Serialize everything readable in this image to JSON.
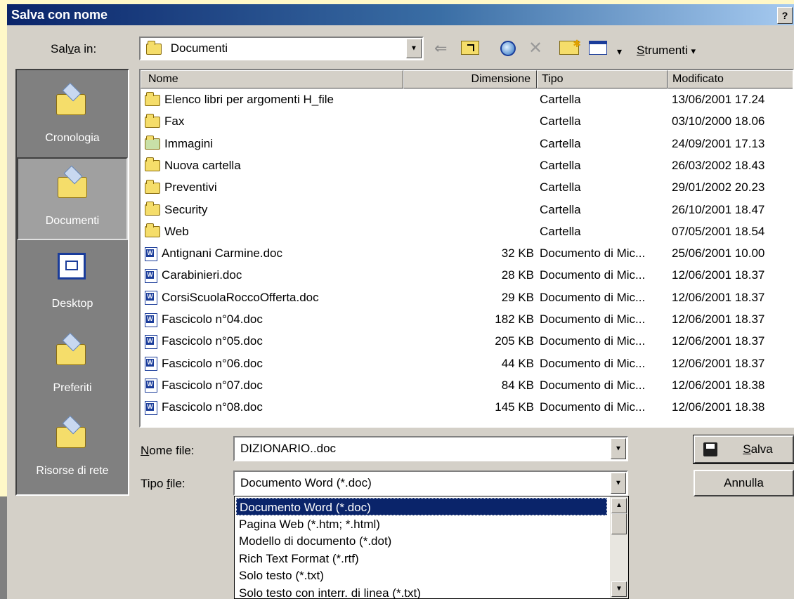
{
  "window": {
    "title": "Salva con nome",
    "help_glyph": "?"
  },
  "lookin": {
    "label_pre": "Sal",
    "label_key": "v",
    "label_post": "a in:",
    "value": "Documenti"
  },
  "toolbar": {
    "icons": [
      "back-arrow-icon",
      "up-folder-icon",
      "search-web-icon",
      "delete-icon",
      "new-folder-icon",
      "views-icon"
    ],
    "tools_key": "S",
    "tools_rest": "trumenti",
    "back_glyph": "⇐",
    "delete_glyph": "✕",
    "dropdown_glyph": "▾"
  },
  "places": [
    {
      "label": "Cronologia",
      "icon": "history-icon"
    },
    {
      "label": "Documenti",
      "icon": "my-documents-icon"
    },
    {
      "label": "Desktop",
      "icon": "desktop-icon"
    },
    {
      "label": "Preferiti",
      "icon": "favorites-icon"
    },
    {
      "label": "Risorse di rete",
      "icon": "network-icon"
    }
  ],
  "columns": {
    "name": "Nome",
    "size": "Dimensione",
    "type": "Tipo",
    "modified": "Modificato"
  },
  "files": [
    {
      "name": "Elenco libri per argomenti H_file",
      "size": "",
      "type": "Cartella",
      "modified": "13/06/2001 17.24",
      "icon": "folder"
    },
    {
      "name": "Fax",
      "size": "",
      "type": "Cartella",
      "modified": "03/10/2000 18.06",
      "icon": "folder"
    },
    {
      "name": "Immagini",
      "size": "",
      "type": "Cartella",
      "modified": "24/09/2001 17.13",
      "icon": "folder-pictures"
    },
    {
      "name": "Nuova cartella",
      "size": "",
      "type": "Cartella",
      "modified": "26/03/2002 18.43",
      "icon": "folder"
    },
    {
      "name": "Preventivi",
      "size": "",
      "type": "Cartella",
      "modified": "29/01/2002 20.23",
      "icon": "folder"
    },
    {
      "name": "Security",
      "size": "",
      "type": "Cartella",
      "modified": "26/10/2001 18.47",
      "icon": "folder"
    },
    {
      "name": "Web",
      "size": "",
      "type": "Cartella",
      "modified": "07/05/2001 18.54",
      "icon": "folder"
    },
    {
      "name": "Antignani Carmine.doc",
      "size": "32 KB",
      "type": "Documento di Mic...",
      "modified": "25/06/2001 10.00",
      "icon": "word-doc"
    },
    {
      "name": "Carabinieri.doc",
      "size": "28 KB",
      "type": "Documento di Mic...",
      "modified": "12/06/2001 18.37",
      "icon": "word-doc"
    },
    {
      "name": "CorsiScuolaRoccoOfferta.doc",
      "size": "29 KB",
      "type": "Documento di Mic...",
      "modified": "12/06/2001 18.37",
      "icon": "word-doc"
    },
    {
      "name": "Fascicolo n°04.doc",
      "size": "182 KB",
      "type": "Documento di Mic...",
      "modified": "12/06/2001 18.37",
      "icon": "word-doc"
    },
    {
      "name": "Fascicolo n°05.doc",
      "size": "205 KB",
      "type": "Documento di Mic...",
      "modified": "12/06/2001 18.37",
      "icon": "word-doc"
    },
    {
      "name": "Fascicolo n°06.doc",
      "size": "44 KB",
      "type": "Documento di Mic...",
      "modified": "12/06/2001 18.37",
      "icon": "word-doc"
    },
    {
      "name": "Fascicolo n°07.doc",
      "size": "84 KB",
      "type": "Documento di Mic...",
      "modified": "12/06/2001 18.38",
      "icon": "word-doc"
    },
    {
      "name": "Fascicolo n°08.doc",
      "size": "145 KB",
      "type": "Documento di Mic...",
      "modified": "12/06/2001 18.38",
      "icon": "word-doc"
    }
  ],
  "filename": {
    "label_key": "N",
    "label_rest": "ome file:",
    "value": "DIZIONARIO..doc"
  },
  "filetype": {
    "label_pre": "Tipo ",
    "label_key": "f",
    "label_post": "ile:",
    "value": "Documento Word (*.doc)",
    "options": [
      "Documento Word (*.doc)",
      "Pagina Web (*.htm; *.html)",
      "Modello di documento (*.dot)",
      "Rich Text Format (*.rtf)",
      "Solo testo (*.txt)",
      "Solo testo con interr. di linea (*.txt)"
    ],
    "selected_index": 0
  },
  "buttons": {
    "save_key": "S",
    "save_rest": "alva",
    "cancel": "Annulla"
  },
  "colors": {
    "titlebar": "#0a246a",
    "dialog_bg": "#d4d0c8",
    "selection": "#0a246a",
    "places_bg": "#808080"
  }
}
